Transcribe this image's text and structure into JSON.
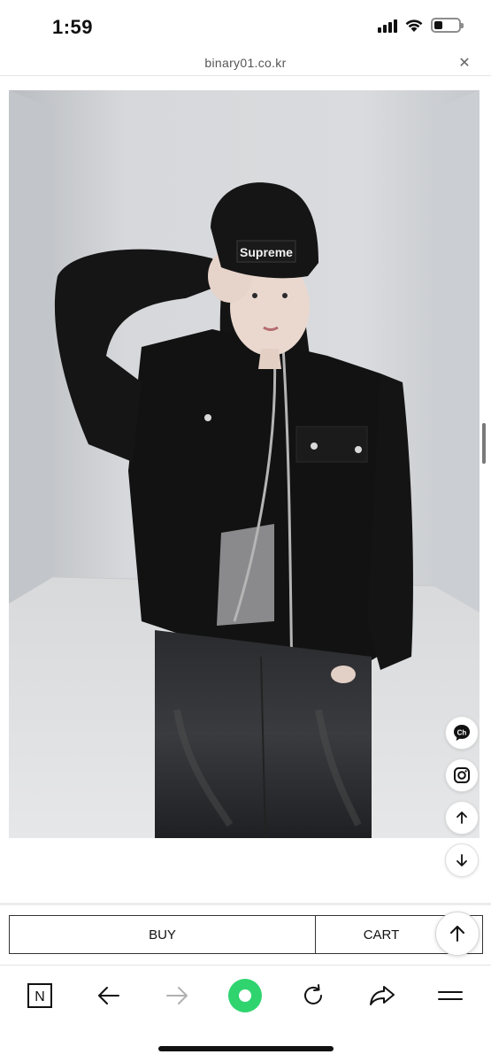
{
  "status_bar": {
    "time": "1:59",
    "icons": [
      "signal-icon",
      "wifi-icon",
      "battery-icon"
    ]
  },
  "url_bar": {
    "url": "binary01.co.kr",
    "close_icon": "close-icon"
  },
  "product": {
    "image_alt": "Model wearing black zip-up knit jacket, grey top, black wide jeans and black beanie",
    "beanie_text": "Supreme"
  },
  "floating_buttons": [
    "channel-talk-icon",
    "instagram-icon",
    "arrow-up-icon",
    "arrow-down-icon"
  ],
  "channel_label": "Ch",
  "actions": {
    "buy_label": "BUY",
    "cart_label": "CART"
  },
  "toolbar": {
    "items": [
      "naver-n-icon",
      "back-arrow-icon",
      "forward-arrow-icon",
      "green-dot-icon",
      "refresh-icon",
      "share-icon",
      "menu-icon"
    ],
    "n_label": "N"
  },
  "colors": {
    "accent_green": "#2fd46f",
    "background": "#ffffff",
    "border": "#333333"
  }
}
